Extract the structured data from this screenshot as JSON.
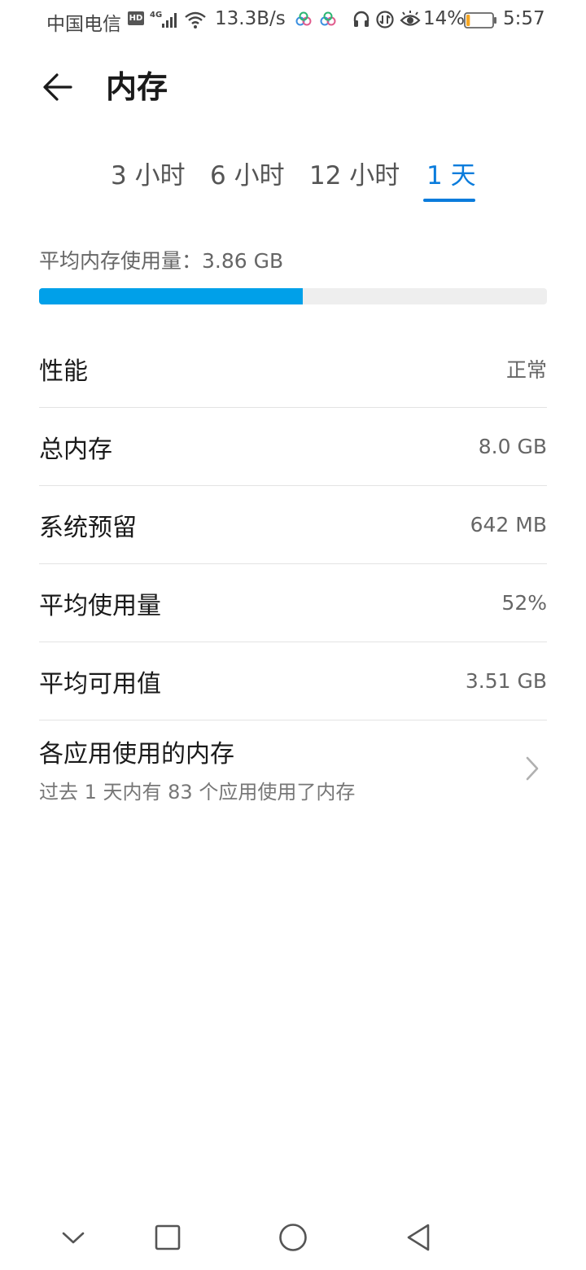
{
  "status_bar": {
    "carrier": "中国电信",
    "hd": "HD",
    "network": "4G",
    "speed": "13.3B/s",
    "battery_pct": "14%",
    "battery_level": 0.14,
    "time": "5:57"
  },
  "header": {
    "title": "内存"
  },
  "tabs": [
    {
      "label": "3 小时",
      "active": false
    },
    {
      "label": "6 小时",
      "active": false
    },
    {
      "label": "12 小时",
      "active": false
    },
    {
      "label": "1 天",
      "active": true
    }
  ],
  "summary": {
    "avg_label": "平均内存使用量：3.86 GB",
    "usage_fraction": 0.52,
    "bar_color": "#00a0e9"
  },
  "rows": [
    {
      "label": "性能",
      "value": "正常"
    },
    {
      "label": "总内存",
      "value": "8.0 GB"
    },
    {
      "label": "系统预留",
      "value": "642 MB"
    },
    {
      "label": "平均使用量",
      "value": "52%"
    },
    {
      "label": "平均可用值",
      "value": "3.51 GB"
    }
  ],
  "apps_row": {
    "title": "各应用使用的内存",
    "subtitle": "过去 1 天内有 83 个应用使用了内存"
  },
  "colors": {
    "accent": "#0a7cdc"
  }
}
